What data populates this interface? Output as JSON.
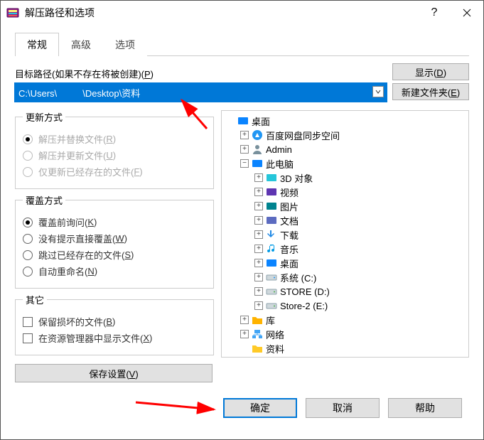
{
  "title": "解压路径和选项",
  "win_help": "?",
  "tabs": {
    "general": "常规",
    "advanced": "高级",
    "options": "选项"
  },
  "path_label": "目标路径(如果不存在将被创建)(",
  "path_label_hotkey": "P",
  "path_label_tail": ")",
  "path_value": "C:\\Users\\          \\Desktop\\资料",
  "btn_show": "显示(",
  "btn_show_hotkey": "D",
  "btn_newfolder": "新建文件夹(",
  "btn_newfolder_hotkey": "E",
  "close_paren": ")",
  "grp_update": "更新方式",
  "upd_replace": "解压并替换文件(",
  "upd_replace_k": "R",
  "upd_update": "解压并更新文件(",
  "upd_update_k": "U",
  "upd_exist": "仅更新已经存在的文件(",
  "upd_exist_k": "F",
  "grp_overwrite": "覆盖方式",
  "ov_ask": "覆盖前询问(",
  "ov_ask_k": "K",
  "ov_silent": "没有提示直接覆盖(",
  "ov_silent_k": "W",
  "ov_skip": "跳过已经存在的文件(",
  "ov_skip_k": "S",
  "ov_rename": "自动重命名(",
  "ov_rename_k": "N",
  "grp_other": "其它",
  "oth_keep": "保留损坏的文件(",
  "oth_keep_k": "B",
  "oth_explorer": "在资源管理器中显示文件(",
  "oth_explorer_k": "X",
  "btn_save": "保存设置(",
  "btn_save_k": "V",
  "btn_ok": "确定",
  "btn_cancel": "取消",
  "btn_help": "帮助",
  "tree": [
    {
      "depth": 0,
      "exp": "none",
      "icon": "desktop",
      "label": "桌面"
    },
    {
      "depth": 1,
      "exp": "plus",
      "icon": "baidu",
      "label": "百度网盘同步空间"
    },
    {
      "depth": 1,
      "exp": "plus",
      "icon": "user",
      "label": "Admin"
    },
    {
      "depth": 1,
      "exp": "minus",
      "icon": "pc",
      "label": "此电脑"
    },
    {
      "depth": 2,
      "exp": "plus",
      "icon": "3d",
      "label": "3D 对象"
    },
    {
      "depth": 2,
      "exp": "plus",
      "icon": "video",
      "label": "视频"
    },
    {
      "depth": 2,
      "exp": "plus",
      "icon": "pictures",
      "label": "图片"
    },
    {
      "depth": 2,
      "exp": "plus",
      "icon": "docs",
      "label": "文档"
    },
    {
      "depth": 2,
      "exp": "plus",
      "icon": "downloads",
      "label": "下载"
    },
    {
      "depth": 2,
      "exp": "plus",
      "icon": "music",
      "label": "音乐"
    },
    {
      "depth": 2,
      "exp": "plus",
      "icon": "desktop",
      "label": "桌面"
    },
    {
      "depth": 2,
      "exp": "plus",
      "icon": "drive-c",
      "label": "系统 (C:)"
    },
    {
      "depth": 2,
      "exp": "plus",
      "icon": "drive",
      "label": "STORE (D:)"
    },
    {
      "depth": 2,
      "exp": "plus",
      "icon": "drive",
      "label": "Store-2 (E:)"
    },
    {
      "depth": 1,
      "exp": "plus",
      "icon": "lib",
      "label": "库"
    },
    {
      "depth": 1,
      "exp": "plus",
      "icon": "network",
      "label": "网络"
    },
    {
      "depth": 1,
      "exp": "none",
      "icon": "folder",
      "label": "资料"
    }
  ]
}
